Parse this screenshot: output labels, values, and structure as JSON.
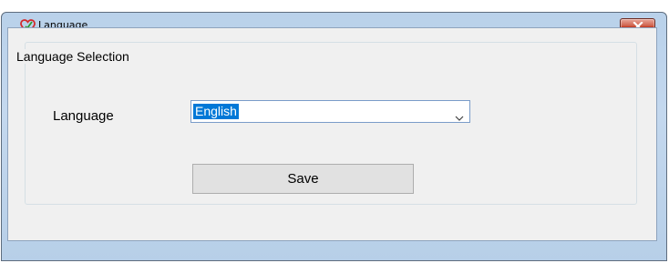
{
  "window": {
    "title": "Language",
    "app_icon": "heart-check-icon",
    "close_icon": "close-icon"
  },
  "group": {
    "legend": "Language Selection"
  },
  "language": {
    "label": "Language",
    "selected": "English",
    "dropdown_icon": "chevron-down-icon"
  },
  "actions": {
    "save_label": "Save"
  },
  "colors": {
    "titlebar": "#b9d1ea",
    "client_bg": "#f0f0f0",
    "selection": "#0078d7",
    "close_button": "#c7432a"
  }
}
